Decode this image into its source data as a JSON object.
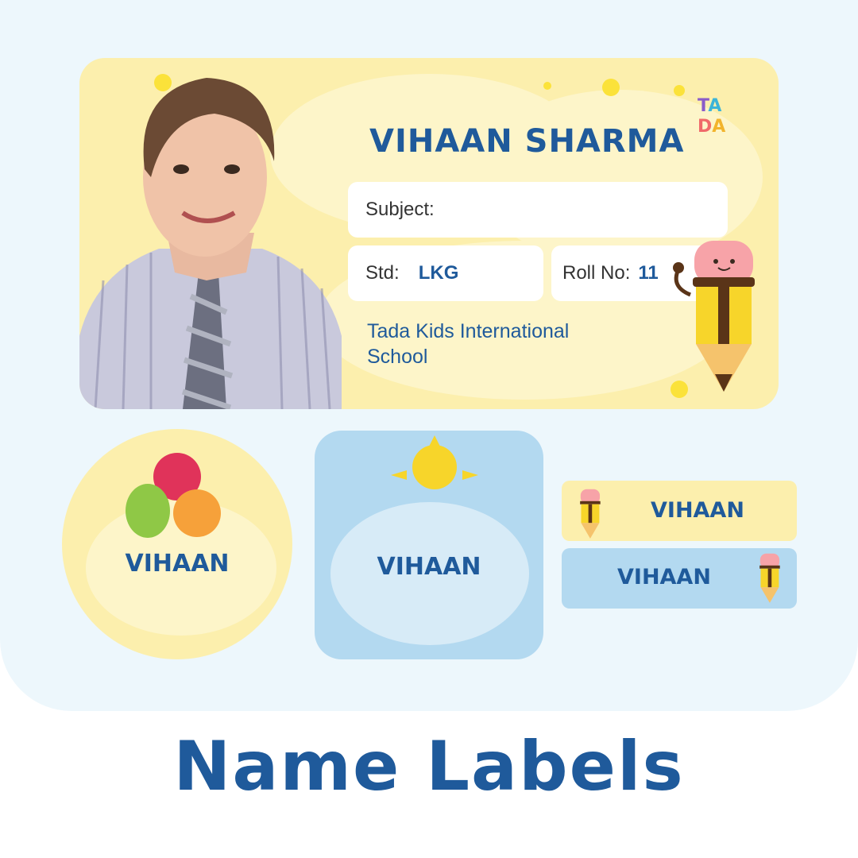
{
  "main_card": {
    "student_name": "VIHAAN SHARMA",
    "subject_label": "Subject:",
    "subject_value": "",
    "std_label": "Std:",
    "std_value": "LKG",
    "roll_label": "Roll No:",
    "roll_value": "11",
    "school_name": "Tada Kids International School",
    "logo_text": "TADA"
  },
  "round_label": {
    "name": "VIHAAN"
  },
  "square_label": {
    "name": "VIHAAN"
  },
  "strip_labels": [
    {
      "name": "VIHAAN"
    },
    {
      "name": "VIHAAN"
    }
  ],
  "title": "Name Labels",
  "colors": {
    "accent": "#1f5a9b",
    "yellow": "#fcefad",
    "blue": "#b3d9f0"
  }
}
